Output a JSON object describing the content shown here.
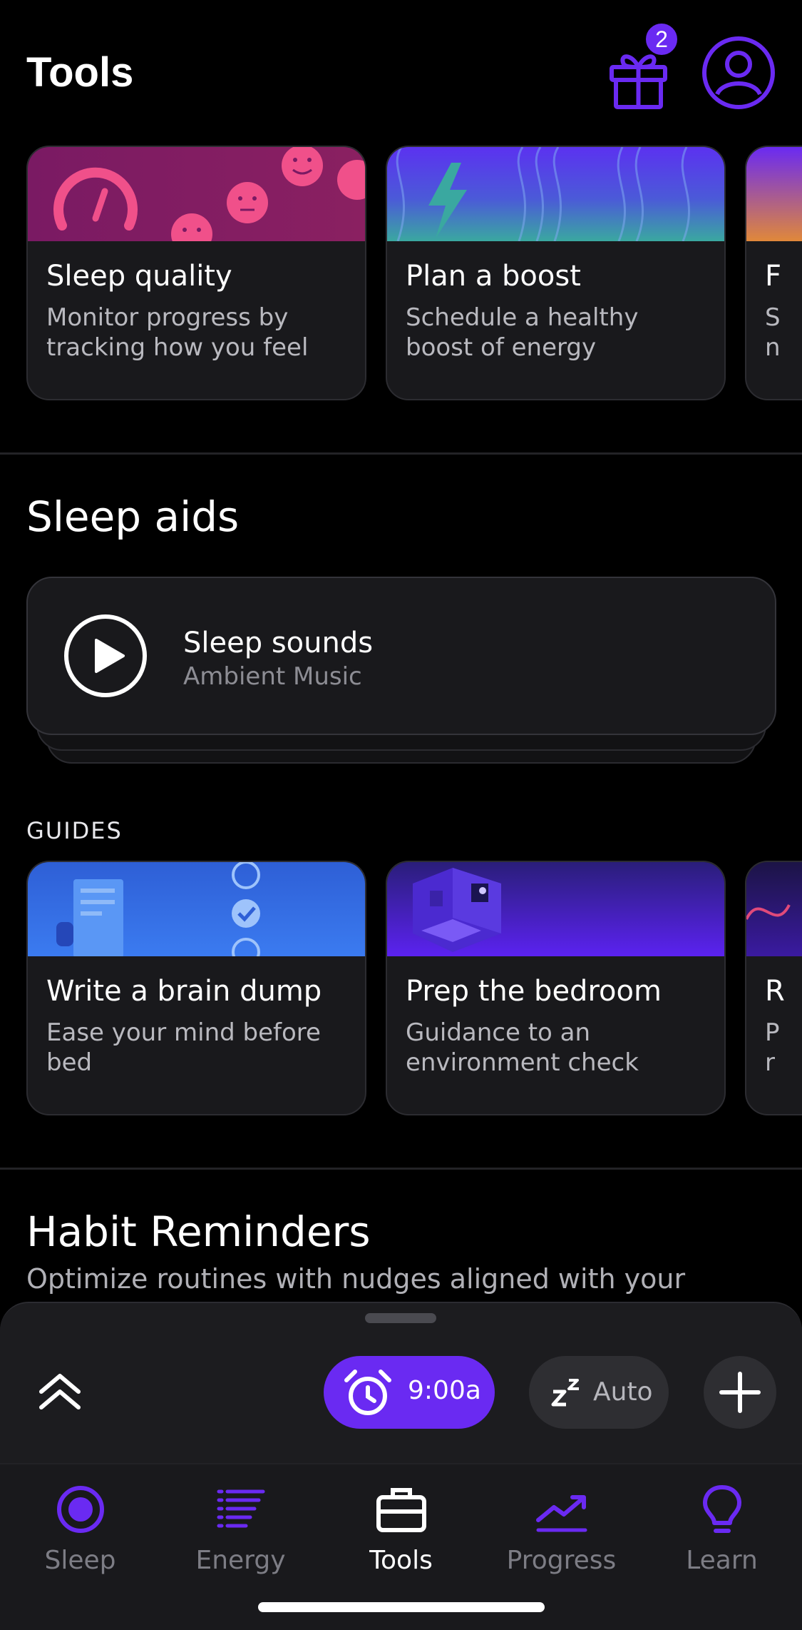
{
  "header": {
    "title": "Tools",
    "gift_badge": "2"
  },
  "tools_cards": [
    {
      "title": "Sleep quality",
      "desc": "Monitor progress by tracking how you feel"
    },
    {
      "title": "Plan a boost",
      "desc": "Schedule a healthy boost of energy"
    },
    {
      "title": "F",
      "desc": "S\nn"
    }
  ],
  "sleep_aids": {
    "title": "Sleep aids",
    "sound_title": "Sleep sounds",
    "sound_sub": "Ambient Music"
  },
  "guides": {
    "label": "GUIDES",
    "cards": [
      {
        "title": "Write a brain dump",
        "desc": "Ease your mind before bed"
      },
      {
        "title": "Prep the bedroom",
        "desc": "Guidance to an environment check"
      },
      {
        "title": "R",
        "desc": "P\nr"
      }
    ]
  },
  "habit": {
    "title": "Habit Reminders",
    "sub": "Optimize routines with nudges aligned with your"
  },
  "sheet": {
    "alarm_label": "9:00a",
    "auto_label": "Auto"
  },
  "tabs": [
    {
      "label": "Sleep",
      "icon": "sleep-icon"
    },
    {
      "label": "Energy",
      "icon": "energy-icon"
    },
    {
      "label": "Tools",
      "icon": "briefcase-icon"
    },
    {
      "label": "Progress",
      "icon": "progress-icon"
    },
    {
      "label": "Learn",
      "icon": "lightbulb-icon"
    }
  ],
  "colors": {
    "accent": "#6a2af2",
    "card": "#19191c",
    "background": "#000000"
  }
}
